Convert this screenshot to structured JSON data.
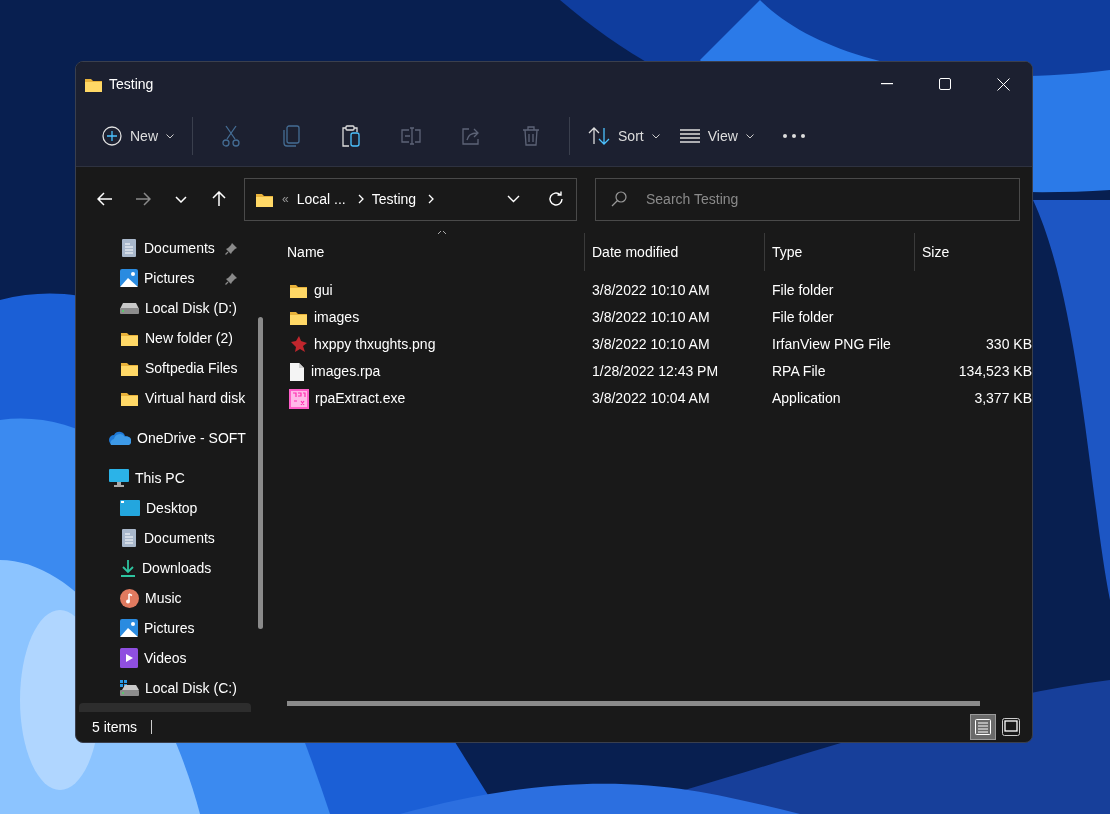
{
  "window": {
    "title": "Testing"
  },
  "toolbar": [
    {
      "kind": "new",
      "label": "New",
      "disabled": false
    },
    {
      "kind": "cut",
      "disabled": true
    },
    {
      "kind": "copy",
      "disabled": true
    },
    {
      "kind": "paste",
      "disabled": false
    },
    {
      "kind": "rename",
      "disabled": true
    },
    {
      "kind": "share",
      "disabled": true
    },
    {
      "kind": "delete",
      "disabled": true
    },
    {
      "kind": "sort",
      "label": "Sort",
      "disabled": false
    },
    {
      "kind": "view",
      "label": "View",
      "disabled": false
    },
    {
      "kind": "more",
      "disabled": false
    }
  ],
  "navigation": {
    "back_disabled": false,
    "forward_disabled": true
  },
  "address_bar": {
    "overflow": "«",
    "path": [
      "Local ...",
      "Testing"
    ]
  },
  "search": {
    "placeholder": "Search Testing"
  },
  "sidebar": {
    "quick_access": [
      {
        "label": "Documents",
        "kind": "documents",
        "pinned": true
      },
      {
        "label": "Pictures",
        "kind": "pictures",
        "pinned": true
      },
      {
        "label": "Local Disk (D:)",
        "kind": "drive",
        "pinned": false
      },
      {
        "label": "New folder (2)",
        "kind": "folder",
        "pinned": false
      },
      {
        "label": "Softpedia Files",
        "kind": "folder",
        "pinned": false
      },
      {
        "label": "Virtual hard disk",
        "kind": "folder",
        "pinned": false
      }
    ],
    "items": [
      {
        "label": "OneDrive - SOFT",
        "kind": "onedrive"
      },
      {
        "label": "This PC",
        "kind": "pc",
        "children": [
          {
            "label": "Desktop",
            "kind": "desktop"
          },
          {
            "label": "Documents",
            "kind": "documents"
          },
          {
            "label": "Downloads",
            "kind": "downloads"
          },
          {
            "label": "Music",
            "kind": "music"
          },
          {
            "label": "Pictures",
            "kind": "pictures"
          },
          {
            "label": "Videos",
            "kind": "videos"
          },
          {
            "label": "Local Disk (C:)",
            "kind": "windrive"
          }
        ]
      }
    ]
  },
  "table": {
    "columns": [
      {
        "label": "Name",
        "sorted": true
      },
      {
        "label": "Date modified",
        "sorted": false
      },
      {
        "label": "Type",
        "sorted": false
      },
      {
        "label": "Size",
        "sorted": false
      }
    ],
    "rows": [
      {
        "kind": "folder",
        "name": "gui",
        "date": "3/8/2022 10:10 AM",
        "type": "File folder"
      },
      {
        "kind": "folder",
        "name": "images",
        "date": "3/8/2022 10:10 AM",
        "type": "File folder"
      },
      {
        "kind": "png",
        "name": "hxppy thxughts.png",
        "date": "3/8/2022 10:10 AM",
        "type": "IrfanView PNG File",
        "size": "330 KB"
      },
      {
        "kind": "file",
        "name": "images.rpa",
        "date": "1/28/2022 12:43 PM",
        "type": "RPA File",
        "size": "134,523 KB"
      },
      {
        "kind": "exe",
        "name": "rpaExtract.exe",
        "date": "3/8/2022 10:04 AM",
        "type": "Application",
        "size": "3,377 KB"
      }
    ]
  },
  "status_bar": {
    "count": "5 items",
    "views": [
      {
        "kind": "details",
        "selected": true
      },
      {
        "kind": "tiles",
        "selected": false
      }
    ]
  }
}
